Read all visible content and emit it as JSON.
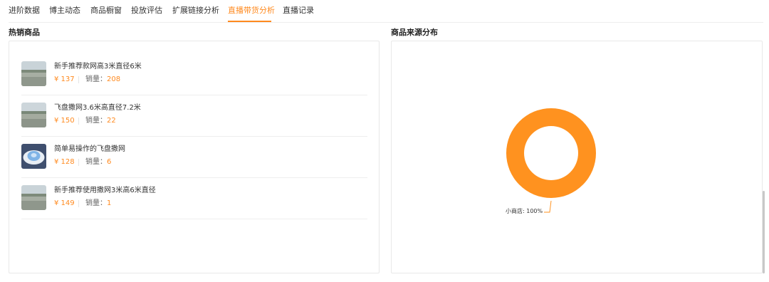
{
  "tabs": [
    {
      "label": "进阶数据",
      "active": false
    },
    {
      "label": "博主动态",
      "active": false
    },
    {
      "label": "商品橱窗",
      "active": false
    },
    {
      "label": "投放评估",
      "active": false
    },
    {
      "label": "扩展链接分析",
      "active": false
    },
    {
      "label": "直播带货分析",
      "active": true
    },
    {
      "label": "直播记录",
      "active": false
    }
  ],
  "hot_products": {
    "title": "热销商品",
    "sales_label": "销量：",
    "items": [
      {
        "name": "新手推荐款网高3米直径6米",
        "price": "¥ 137",
        "sales": "208",
        "thumb": "landscape"
      },
      {
        "name": "飞盘撒网3.6米高直径7.2米",
        "price": "¥ 150",
        "sales": "22",
        "thumb": "landscape"
      },
      {
        "name": "简单易操作的飞盘撒网",
        "price": "¥ 128",
        "sales": "6",
        "thumb": "net"
      },
      {
        "name": "新手推荐使用撒网3米高6米直径",
        "price": "¥ 149",
        "sales": "1",
        "thumb": "landscape"
      }
    ]
  },
  "source_distribution": {
    "title": "商品来源分布"
  },
  "chart_data": {
    "type": "pie",
    "donut": true,
    "categories": [
      "小商店"
    ],
    "values": [
      100
    ],
    "slice_labels": [
      "小商店: 100%"
    ],
    "colors": [
      "#ff921f"
    ]
  },
  "colors": {
    "accent": "#ff8a1f",
    "slice": "#ff921f"
  }
}
